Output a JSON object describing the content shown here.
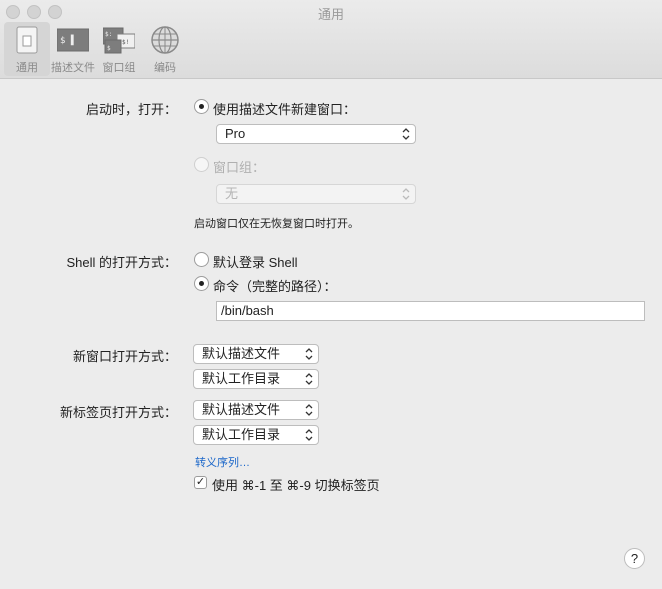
{
  "window": {
    "title": "通用"
  },
  "toolbar": {
    "items": [
      {
        "label": "通用",
        "icon": "switch-icon",
        "selected": true
      },
      {
        "label": "描述文件",
        "icon": "terminal-profile-icon",
        "selected": false
      },
      {
        "label": "窗口组",
        "icon": "window-group-icon",
        "selected": false
      },
      {
        "label": "编码",
        "icon": "globe-icon",
        "selected": false
      }
    ]
  },
  "startup": {
    "label": "启动时，打开：",
    "new_window_option": "使用描述文件新建窗口：",
    "profile_value": "Pro",
    "window_group_option": "窗口组：",
    "window_group_value": "无",
    "note": "启动窗口仅在无恢复窗口时打开。"
  },
  "shell": {
    "label": "Shell 的打开方式：",
    "default_login_option": "默认登录 Shell",
    "command_option": "命令（完整的路径）：",
    "command_value": "/bin/bash"
  },
  "new_window": {
    "label": "新窗口打开方式：",
    "profile_value": "默认描述文件",
    "directory_value": "默认工作目录"
  },
  "new_tab": {
    "label": "新标签页打开方式：",
    "profile_value": "默认描述文件",
    "directory_value": "默认工作目录"
  },
  "escape_sequences_link": "转义序列…",
  "tab_shortcut": {
    "label": "使用 ⌘-1 至 ⌘-9 切换标签页",
    "checked": true,
    "check_glyph": "✓"
  },
  "help": {
    "glyph": "?"
  },
  "colors": {
    "link": "#1a66c9",
    "background": "#ececec"
  }
}
